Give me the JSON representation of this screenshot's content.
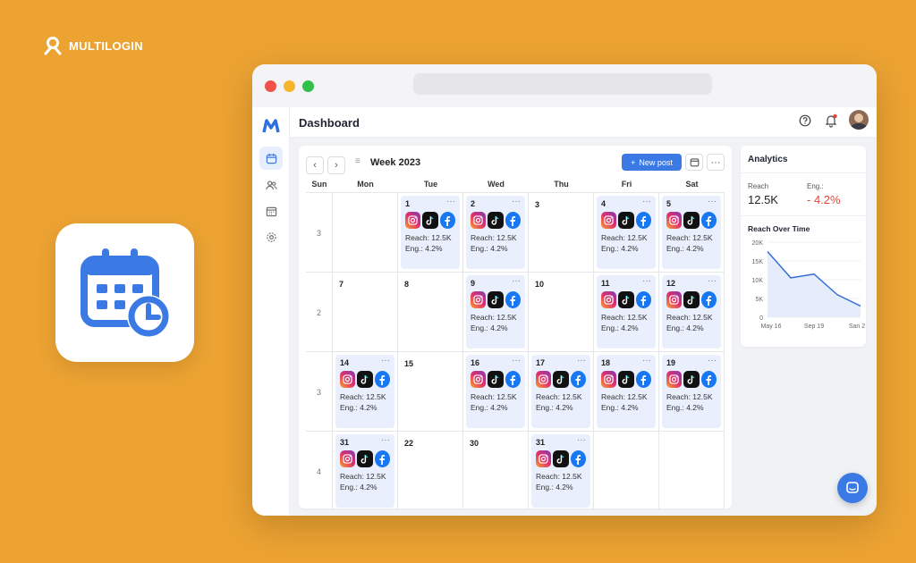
{
  "brand": {
    "name": "MULTILOGIN"
  },
  "header": {
    "title": "Dashboard"
  },
  "toolbar": {
    "week_label": "Week 2023",
    "new_post_label": "New post"
  },
  "calendar": {
    "day_headers": [
      "Sun",
      "Mon",
      "Tue",
      "Wed",
      "Thu",
      "Fri",
      "Sat"
    ],
    "rows": [
      {
        "week": "3",
        "cells": [
          {
            "date": "",
            "post": false
          },
          {
            "date": "1",
            "post": true,
            "reach": "Reach: 12.5K",
            "eng": "Eng.: 4.2%"
          },
          {
            "date": "2",
            "post": true,
            "reach": "Reach: 12.5K",
            "eng": "Eng.: 4.2%"
          },
          {
            "date": "3",
            "post": false
          },
          {
            "date": "4",
            "post": true,
            "reach": "Reach: 12.5K",
            "eng": "Eng.: 4.2%"
          },
          {
            "date": "5",
            "post": true,
            "reach": "Reach: 12.5K",
            "eng": "Eng.: 4.2%"
          }
        ]
      },
      {
        "week": "2",
        "cells": [
          {
            "date": "7",
            "post": false
          },
          {
            "date": "8",
            "post": false
          },
          {
            "date": "9",
            "post": true,
            "reach": "Reach: 12.5K",
            "eng": "Eng.: 4.2%"
          },
          {
            "date": "10",
            "post": false
          },
          {
            "date": "11",
            "post": true,
            "reach": "Reach: 12.5K",
            "eng": "Eng.: 4.2%"
          },
          {
            "date": "12",
            "post": true,
            "reach": "Reach: 12.5K",
            "eng": "Eng.: 4.2%"
          }
        ]
      },
      {
        "week": "3",
        "cells": [
          {
            "date": "14",
            "post": true,
            "reach": "Reach: 12.5K",
            "eng": "Eng.: 4.2%"
          },
          {
            "date": "15",
            "post": false
          },
          {
            "date": "16",
            "post": true,
            "reach": "Reach: 12.5K",
            "eng": "Eng.: 4.2%"
          },
          {
            "date": "17",
            "post": true,
            "reach": "Reach: 12.5K",
            "eng": "Eng.: 4.2%"
          },
          {
            "date": "18",
            "post": true,
            "reach": "Reach: 12.5K",
            "eng": "Eng.: 4.2%"
          },
          {
            "date": "19",
            "post": true,
            "reach": "Reach: 12.5K",
            "eng": "Eng.: 4.2%"
          }
        ]
      },
      {
        "week": "4",
        "cells": [
          {
            "date": "31",
            "post": true,
            "reach": "Reach: 12.5K",
            "eng": "Eng.: 4.2%"
          },
          {
            "date": "22",
            "post": false
          },
          {
            "date": "30",
            "post": false
          },
          {
            "date": "31",
            "post": true,
            "reach": "Reach: 12.5K",
            "eng": "Eng.: 4.2%"
          },
          {
            "date": "",
            "post": false
          },
          {
            "date": "",
            "post": false
          }
        ]
      }
    ]
  },
  "analytics": {
    "title": "Analytics",
    "reach_label": "Reach",
    "reach_value": "12.5K",
    "eng_label": "Eng.:",
    "eng_value": "- 4.2%",
    "chart_title": "Reach Over Time"
  },
  "chart_data": {
    "type": "area",
    "title": "Reach Over Time",
    "x": [
      "May 16",
      "",
      "Sep 19",
      "",
      "",
      "San 2"
    ],
    "x_tick_labels": [
      "May 16",
      "Sep 19",
      "San 2"
    ],
    "y_tick_labels": [
      "0",
      "5K",
      "10K",
      "15K",
      "20K"
    ],
    "ylim": [
      0,
      20000
    ],
    "series": [
      {
        "values": [
          17500,
          10500,
          11500,
          6000,
          3000
        ]
      }
    ]
  },
  "colors": {
    "accent": "#3b79e4",
    "background": "#ECA332",
    "negative": "#e0463a"
  }
}
